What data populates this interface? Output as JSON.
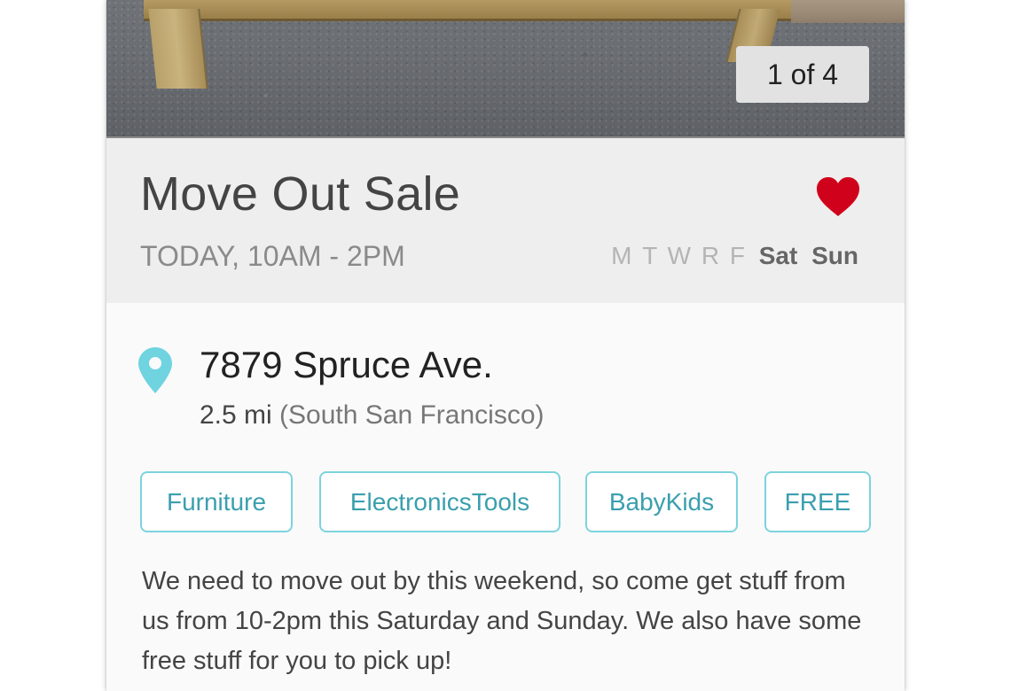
{
  "listing": {
    "photo_counter": "1 of 4",
    "title": "Move Out Sale",
    "time_range": "TODAY, 10AM - 2PM",
    "favorited": true,
    "heart_color": "#d0021b",
    "days": {
      "inactive": [
        "M",
        "T",
        "W",
        "R",
        "F"
      ],
      "active": [
        "Sat",
        "Sun"
      ]
    },
    "address": "7879 Spruce Ave.",
    "distance": "2.5 mi",
    "city": "(South San Francisco)",
    "pin_icon": "map-pin-icon",
    "pin_color": "#6fd3e0",
    "tags": [
      "Furniture",
      "ElectronicsTools",
      "BabyKids",
      "FREE"
    ],
    "tag_color": "#3a9fae",
    "description": "We need to move out by this weekend, so come get stuff from us from 10-2pm this Saturday and Sunday. We also have some free stuff for you to pick up!"
  }
}
